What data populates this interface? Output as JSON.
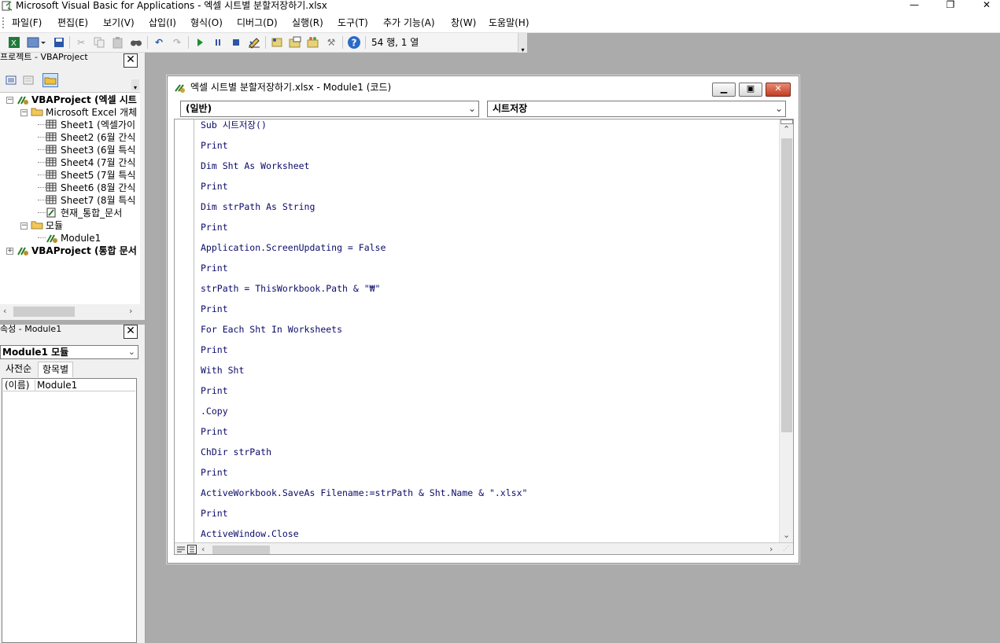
{
  "window": {
    "title": "Microsoft Visual Basic for Applications - 엑셀 시트별 분할저장하기.xlsx",
    "controls": [
      "—",
      "❐",
      "✕"
    ]
  },
  "menu": [
    "파일(F)",
    "편집(E)",
    "보기(V)",
    "삽입(I)",
    "형식(O)",
    "디버그(D)",
    "실행(R)",
    "도구(T)",
    "추가 기능(A)",
    "창(W)",
    "도움말(H)"
  ],
  "toolbar": {
    "icons": [
      "excel-icon",
      "insert-module-icon",
      "save-icon",
      "cut-icon",
      "copy-icon",
      "paste-icon",
      "find-icon",
      "undo-icon",
      "redo-icon",
      "run-icon",
      "break-icon",
      "reset-icon",
      "design-mode-icon",
      "project-explorer-icon",
      "properties-icon",
      "object-browser-icon",
      "toolbox-icon",
      "help-icon"
    ],
    "status": "54 행, 1 열"
  },
  "project": {
    "title": "프로젝트 - VBAProject",
    "tree": [
      {
        "label": "VBAProject (엑셀 시트",
        "bold": true,
        "level": 0,
        "exp": "−",
        "icon": "vba"
      },
      {
        "label": "Microsoft Excel 개체",
        "level": 1,
        "exp": "−",
        "icon": "folder"
      },
      {
        "label": "Sheet1 (엑셀가이",
        "level": 2,
        "icon": "sheet"
      },
      {
        "label": "Sheet2 (6월 간식",
        "level": 2,
        "icon": "sheet"
      },
      {
        "label": "Sheet3 (6월 특식",
        "level": 2,
        "icon": "sheet"
      },
      {
        "label": "Sheet4 (7월 간식",
        "level": 2,
        "icon": "sheet"
      },
      {
        "label": "Sheet5 (7월 특식",
        "level": 2,
        "icon": "sheet"
      },
      {
        "label": "Sheet6 (8월 간식",
        "level": 2,
        "icon": "sheet"
      },
      {
        "label": "Sheet7 (8월 특식",
        "level": 2,
        "icon": "sheet"
      },
      {
        "label": "현재_통합_문서",
        "level": 2,
        "icon": "workbook"
      },
      {
        "label": "모듈",
        "level": 1,
        "exp": "−",
        "icon": "folder"
      },
      {
        "label": "Module1",
        "level": 2,
        "icon": "module"
      },
      {
        "label": "VBAProject (통합 문서",
        "bold": true,
        "level": 0,
        "exp": "+",
        "icon": "vba"
      }
    ]
  },
  "properties": {
    "title": "속성 - Module1",
    "object": "Module1 모듈",
    "tabs": [
      "사전순",
      "항목별"
    ],
    "row_name": "(이름)",
    "row_value": "Module1"
  },
  "code": {
    "title": "엑셀 시트별 분할저장하기.xlsx - Module1 (코드)",
    "object_combo": "(일반)",
    "proc_combo": "시트저장",
    "lines": [
      "Sub 시트저장()",
      "Print",
      "Dim Sht As Worksheet",
      "Print",
      "Dim strPath As String",
      "Print",
      "Application.ScreenUpdating = False",
      "Print",
      "strPath = ThisWorkbook.Path & \"₩\"",
      "Print",
      "For Each Sht In Worksheets",
      "Print",
      "With Sht",
      "Print",
      ".Copy",
      "Print",
      "ChDir strPath",
      "Print",
      "ActiveWorkbook.SaveAs Filename:=strPath & Sht.Name & \".xlsx\"",
      "Print",
      "ActiveWindow.Close"
    ]
  },
  "colors": {
    "background": "#ababab",
    "code_text": "#0b0b6a",
    "close_red": "#c33c21"
  }
}
